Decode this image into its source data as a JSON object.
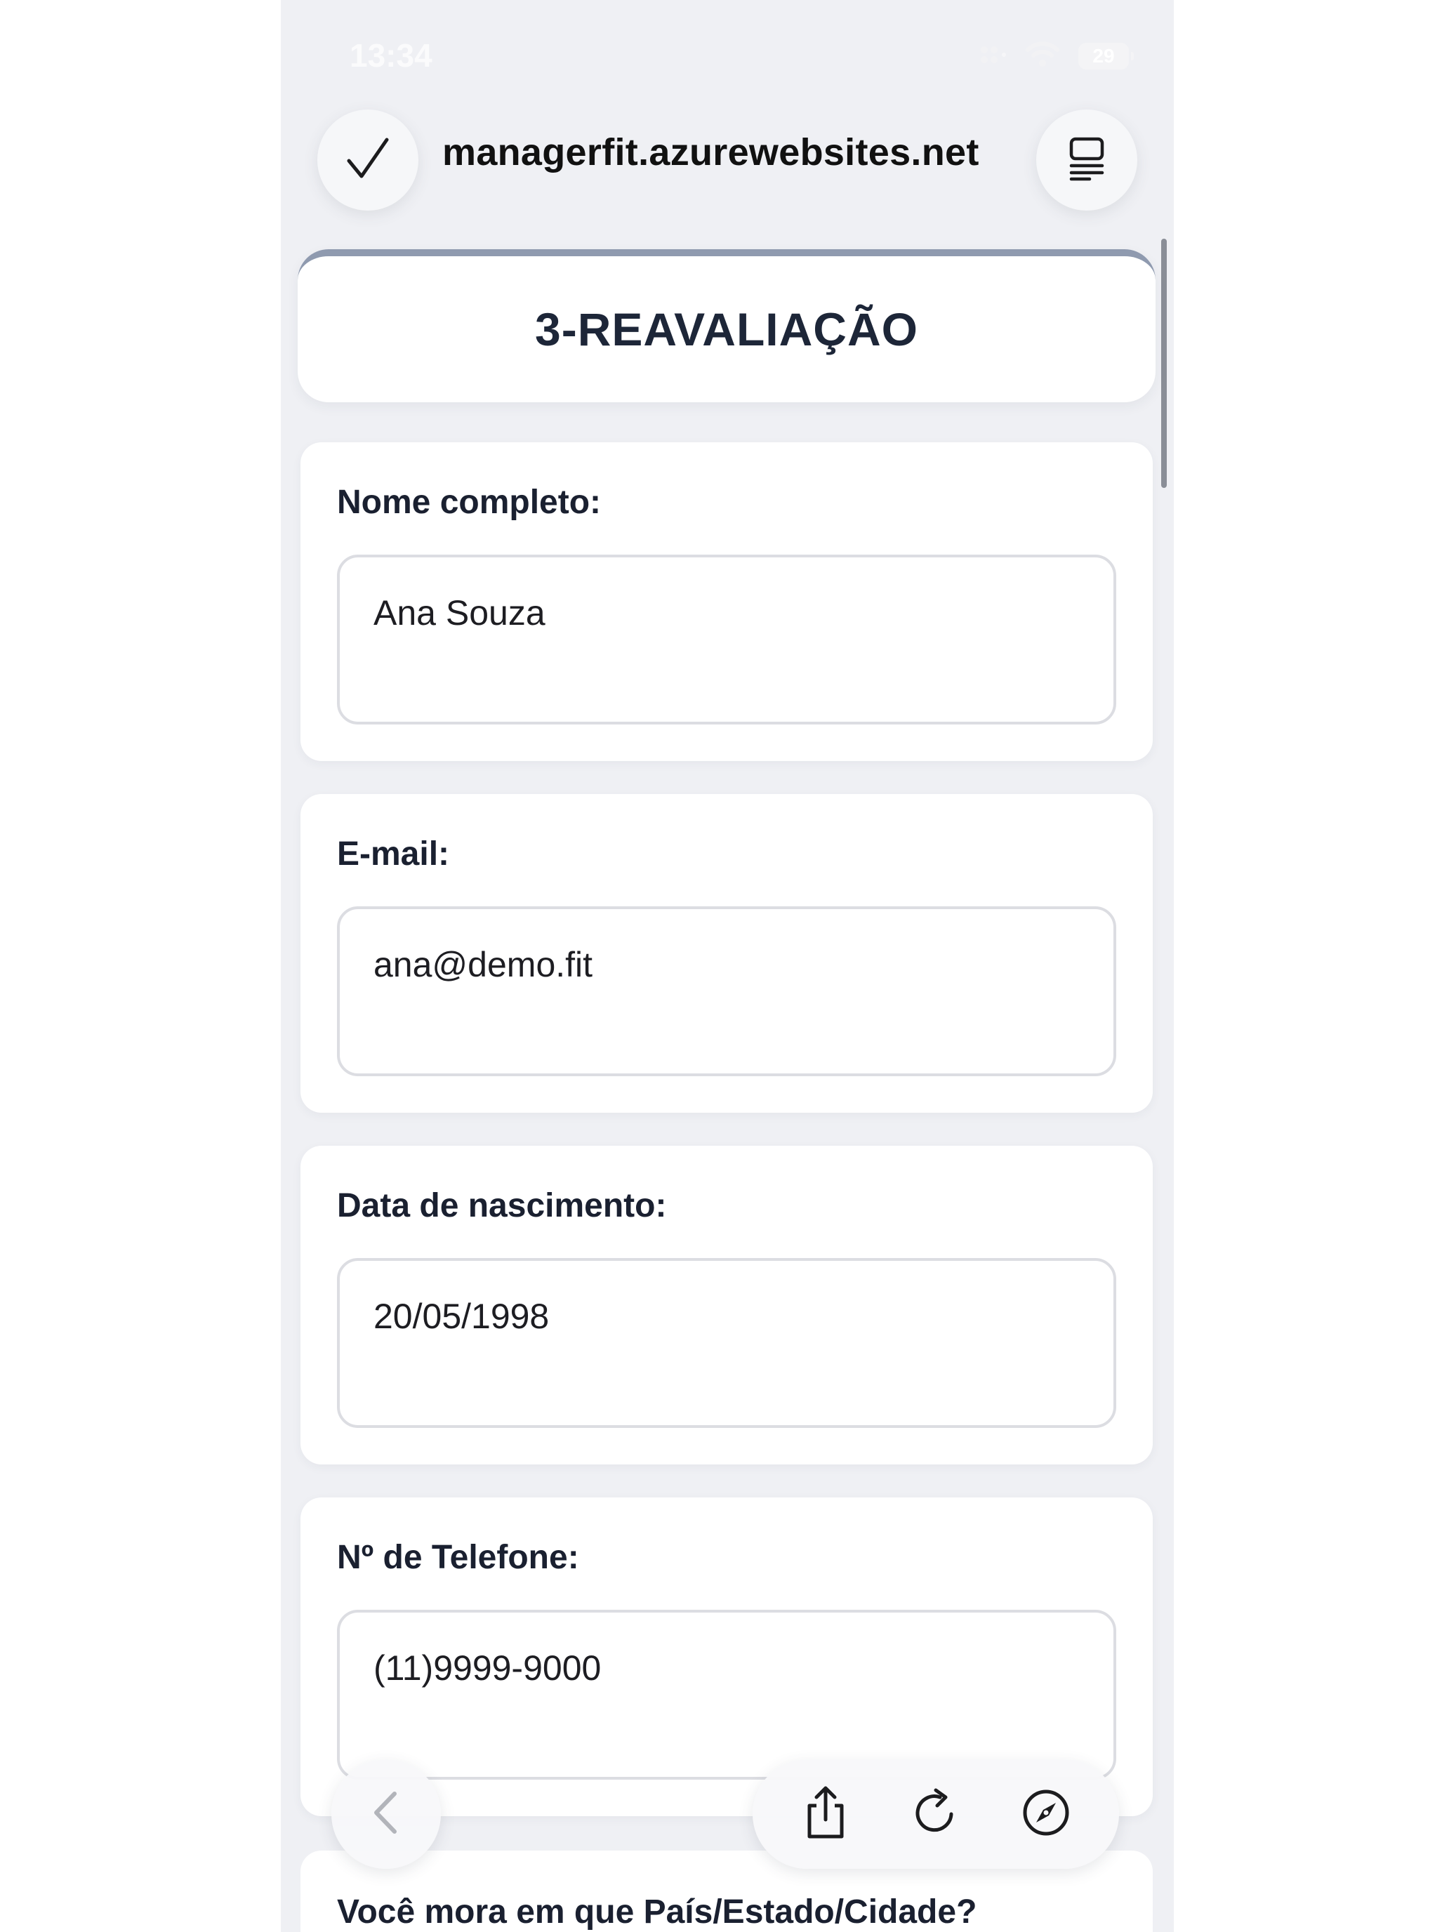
{
  "status_bar": {
    "time": "13:34",
    "battery": "29",
    "icons": [
      "signal-icon",
      "wifi-icon",
      "battery-icon"
    ]
  },
  "browser": {
    "url": "managerfit.azurewebsites.net",
    "left_button_icon": "checkmark-icon",
    "right_button_icon": "reader-mode-icon",
    "toolbar_icons": [
      "back-arrow-icon",
      "share-icon",
      "reload-icon",
      "compass-icon"
    ]
  },
  "form": {
    "title": "3-REAVALIAÇÃO",
    "fields": [
      {
        "label": "Nome completo:",
        "value": "Ana Souza"
      },
      {
        "label": "E-mail:",
        "value": "ana@demo.fit"
      },
      {
        "label": "Data de nascimento:",
        "value": "20/05/1998"
      },
      {
        "label": "Nº de Telefone:",
        "value": "(11)9999-9000"
      }
    ],
    "next_question": "Você mora em que País/Estado/Cidade?"
  },
  "colors": {
    "background": "#eff0f4",
    "card": "#ffffff",
    "title_accent": "#8f9aaf",
    "text_dark": "#1a2030",
    "field_border": "#dcdde2"
  }
}
